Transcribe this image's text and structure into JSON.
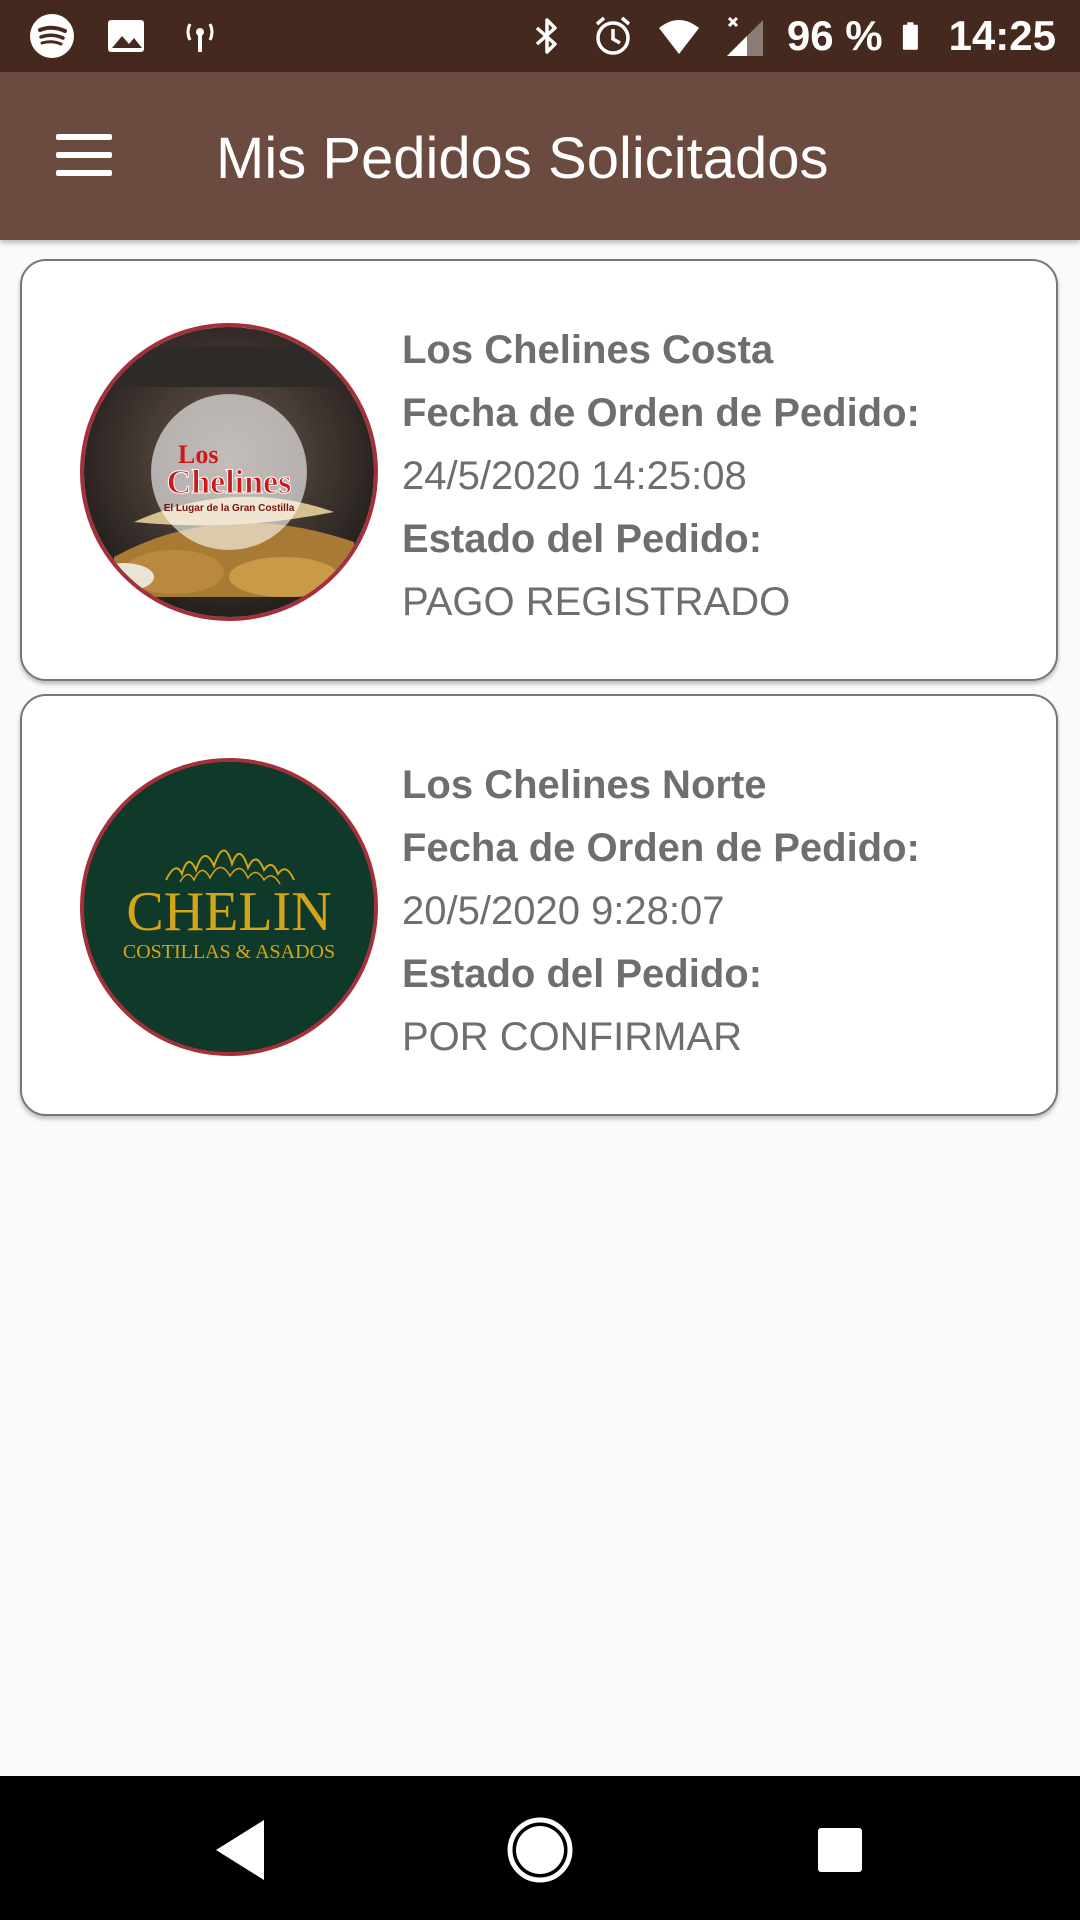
{
  "status_bar": {
    "left_icons": [
      "spotify-icon",
      "image-icon",
      "broadcast-icon"
    ],
    "right_icons": [
      "bluetooth-icon",
      "alarm-icon",
      "wifi-icon",
      "cell-signal-icon"
    ],
    "battery_percent": "96 %",
    "battery_level": 0.96,
    "time": "14:25"
  },
  "app_bar": {
    "title": "Mis Pedidos Solicitados",
    "menu_icon": "hamburger-menu-icon"
  },
  "orders": [
    {
      "restaurant": "Los Chelines Costa",
      "date_label": "Fecha de Orden de Pedido:",
      "date_value": "24/5/2020 14:25:08",
      "status_label": "Estado del Pedido:",
      "status_value": "PAGO REGISTRADO",
      "logo": {
        "line1": "Los",
        "line2": "Chelines",
        "tagline": "El Lugar de la Gran Costilla"
      }
    },
    {
      "restaurant": "Los Chelines Norte",
      "date_label": "Fecha de Orden de Pedido:",
      "date_value": "20/5/2020 9:28:07",
      "status_label": "Estado del Pedido:",
      "status_value": "POR CONFIRMAR",
      "logo": {
        "line1": "CHELIN",
        "line2": "COSTILLAS & ASADOS"
      }
    }
  ],
  "colors": {
    "status_bar": "#45291f",
    "app_bar": "#6b4a3f",
    "background": "#fafafa",
    "thumb_border": "#a3303a",
    "chelin_green": "#0f3a2a",
    "chelin_gold": "#d4a419"
  },
  "nav_bar": {
    "buttons": [
      "back-icon",
      "home-icon",
      "recents-icon"
    ]
  }
}
